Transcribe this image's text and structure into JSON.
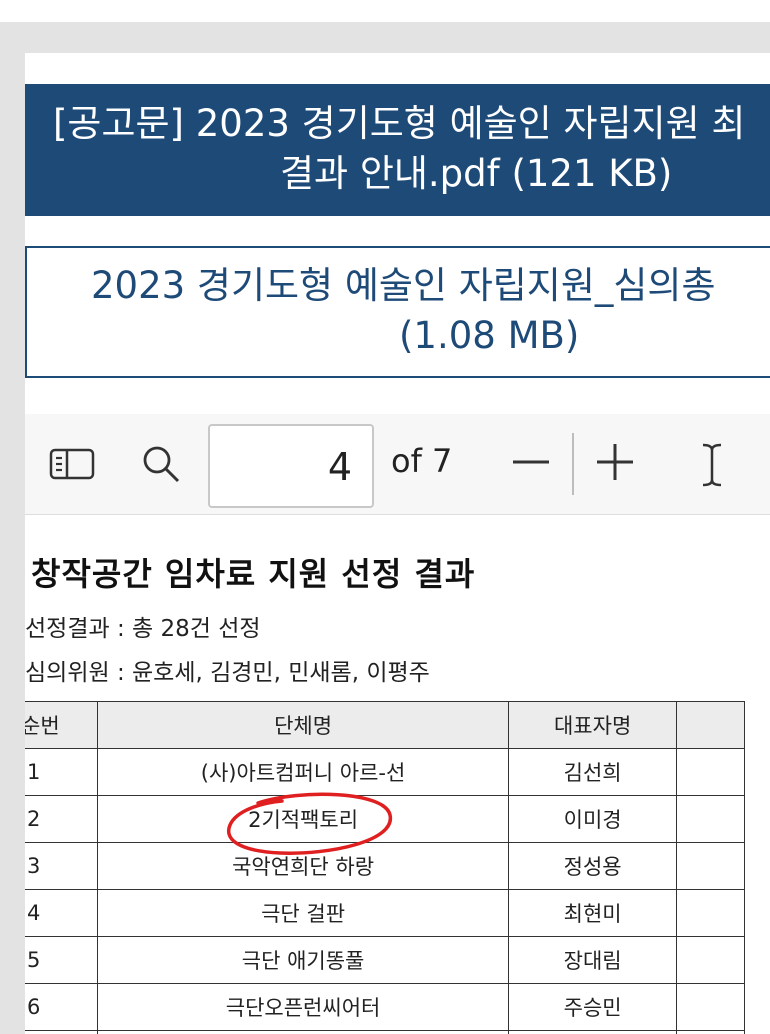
{
  "file_title": {
    "line1": "[공고문] 2023 경기도형 예술인 자립지원 최",
    "line2": "결과 안내.pdf (121 KB)"
  },
  "file_link": {
    "line1": "2023 경기도형 예술인 자립지원_심의총",
    "line2": "(1.08 MB)"
  },
  "toolbar": {
    "sidebar_icon": "sidebar-toggle-icon",
    "search_icon": "search-icon",
    "page_value": "4",
    "page_of": "of 7",
    "zoom_out_icon": "minus-icon",
    "zoom_in_icon": "plus-icon",
    "text_select_icon": "text-cursor-icon"
  },
  "document": {
    "heading": "창작공간 임차료 지원 선정 결과",
    "selection_result": "선정결과 : 총 28건 선정",
    "reviewers": "심의위원 : 윤호세, 김경민, 민새롬, 이평주",
    "table": {
      "headers": [
        "순번",
        "단체명",
        "대표자명",
        ""
      ],
      "rows": [
        {
          "no": "1",
          "name": "(사)아트컴퍼니 아르-선",
          "rep": "김선희"
        },
        {
          "no": "2",
          "name": "2기적팩토리",
          "rep": "이미경"
        },
        {
          "no": "3",
          "name": "국악연희단 하랑",
          "rep": "정성용"
        },
        {
          "no": "4",
          "name": "극단 걸판",
          "rep": "최현미"
        },
        {
          "no": "5",
          "name": "극단 애기똥풀",
          "rep": "장대림"
        },
        {
          "no": "6",
          "name": "극단오픈런씨어터",
          "rep": "주승민"
        }
      ]
    },
    "annotation_color": "#e02020"
  },
  "colors": {
    "banner": "#1e4a78",
    "background": "#e3e3e3"
  }
}
